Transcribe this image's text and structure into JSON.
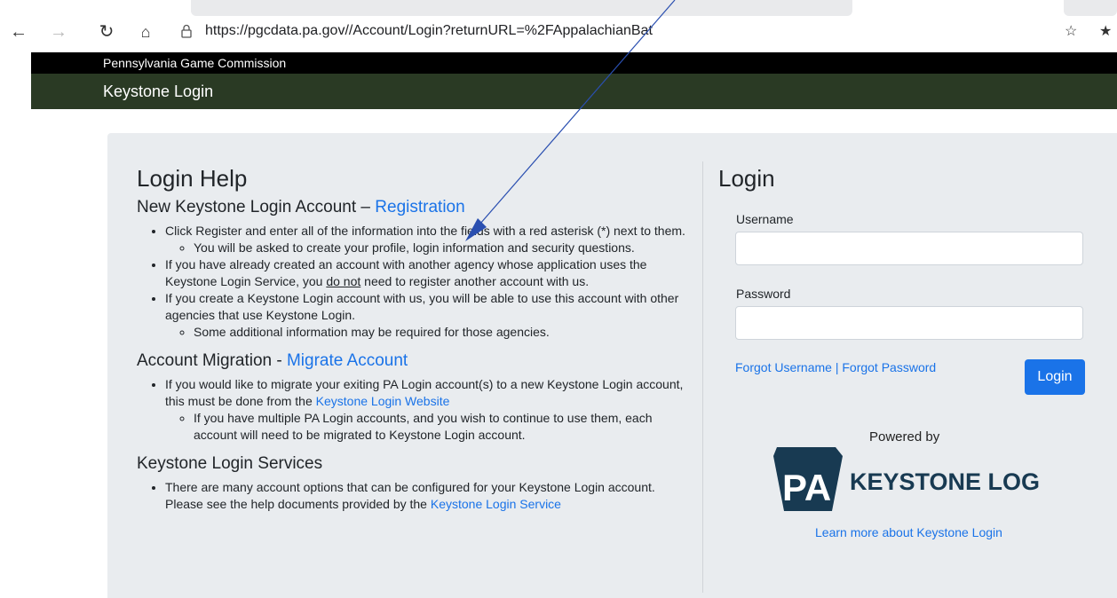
{
  "browser": {
    "url": "https://pgcdata.pa.gov//Account/Login?returnURL=%2FAppalachianBat"
  },
  "agency": {
    "name": "Pennsylvania Game Commission"
  },
  "header": {
    "title": "Keystone Login"
  },
  "help": {
    "title": "Login Help",
    "sections": {
      "new_account": {
        "heading": "New Keystone Login Account – ",
        "link": "Registration",
        "item1": "Click Register and enter all of the information into the fields with a red asterisk (*) next to them.",
        "item1_sub": "You will be asked to create your profile, login information and security questions.",
        "item2_pre": "If you have already created an account with another agency whose application uses the Keystone Login Service, you ",
        "item2_em": "do not",
        "item2_post": " need to register another account with us.",
        "item3": "If you create a Keystone Login account with us, you will be able to use this account with other agencies that use Keystone Login.",
        "item3_sub": "Some additional information may be required for those agencies."
      },
      "migration": {
        "heading": "Account Migration - ",
        "link": "Migrate Account",
        "item1_pre": "If you would like to migrate your exiting PA Login account(s) to a new Keystone Login account, this must be done from the ",
        "item1_link": "Keystone Login Website",
        "item1_sub": "If you have multiple PA Login accounts, and you wish to continue to use them, each account will need to be migrated to Keystone Login account."
      },
      "services": {
        "heading": "Keystone Login Services",
        "item1_pre": "There are many account options that can be configured for your Keystone Login account. Please see the help documents provided by the ",
        "item1_link": "Keystone Login Service"
      }
    }
  },
  "login": {
    "title": "Login",
    "username_label": "Username",
    "username_value": "",
    "password_label": "Password",
    "password_value": "",
    "forgot_username": "Forgot Username",
    "separator": " | ",
    "forgot_password": "Forgot Password",
    "button": "Login",
    "powered_by": "Powered by",
    "logo_pa": "PA",
    "logo_text": "KEYSTONE LOGIN",
    "learn_more": "Learn more about Keystone Login"
  },
  "colors": {
    "header_green": "#2a3a24",
    "link_blue": "#1a73e8",
    "panel_gray": "#e9ecef",
    "logo_navy": "#183a52"
  }
}
